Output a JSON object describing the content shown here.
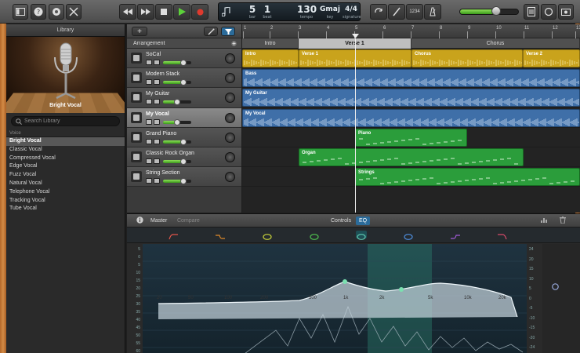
{
  "colors": {
    "region_yellow": "#c9a31c",
    "region_blue": "#3f6fa8",
    "region_green": "#2b9d3b",
    "accent_blue": "#2b6b9a",
    "eq_teal": "#5ec9b0"
  },
  "toolbar": {
    "buttons_left": [
      "library-icon",
      "help-icon",
      "smart-controls-icon",
      "editors-icon"
    ],
    "transport": [
      "rewind-icon",
      "forward-icon",
      "stop-icon",
      "play-icon",
      "record-icon"
    ],
    "lcd": {
      "bar": "5",
      "beat": "1",
      "bar_label": "bar",
      "beat_label": "beat",
      "tempo": "130",
      "tempo_label": "tempo",
      "key": "Gmaj",
      "key_label": "key",
      "signature": "4/4",
      "signature_label": "signature"
    },
    "count_in": "1234",
    "master_volume": 0.6
  },
  "library": {
    "title": "Library",
    "image_label": "Bright Vocal",
    "search_placeholder": "Search Library",
    "category": "Voice",
    "items": [
      "Bright Vocal",
      "Classic Vocal",
      "Compressed Vocal",
      "Edge Vocal",
      "Fuzz Vocal",
      "Natural Vocal",
      "Telephone Vocal",
      "Tracking Vocal",
      "Tube Vocal"
    ],
    "selected_index": 0
  },
  "tracks_head": {
    "add_label": "+",
    "arrangement_label": "Arrangement"
  },
  "tracks": [
    {
      "name": "SoCal",
      "icon": "drums-icon",
      "volume": 0.72
    },
    {
      "name": "Modern Stack",
      "icon": "bass-amp-icon",
      "volume": 0.72
    },
    {
      "name": "My Guitar",
      "icon": "guitar-icon",
      "volume": 0.5
    },
    {
      "name": "My Vocal",
      "icon": "microphone-icon",
      "volume": 0.5,
      "selected": true
    },
    {
      "name": "Grand Piano",
      "icon": "piano-icon",
      "volume": 0.72
    },
    {
      "name": "Classic Rock Organ",
      "icon": "organ-icon",
      "volume": 0.72
    },
    {
      "name": "String Section",
      "icon": "strings-icon",
      "volume": 0.72
    }
  ],
  "timeline": {
    "ruler": [
      "1",
      "2",
      "3",
      "4",
      "5",
      "6",
      "7",
      "8",
      "9",
      "10",
      "11",
      "12",
      "13"
    ],
    "sections": [
      {
        "label": "Intro"
      },
      {
        "label": "Verse 1",
        "selected": true
      },
      {
        "label": "Chorus"
      }
    ],
    "lanes": [
      [
        {
          "label": "Intro",
          "color": "yellow"
        },
        {
          "label": "Verse 1",
          "color": "yellow"
        },
        {
          "label": "Chorus",
          "color": "yellow"
        },
        {
          "label": "Verse 2",
          "color": "yellow"
        }
      ],
      [
        {
          "label": "Bass",
          "color": "blue"
        }
      ],
      [
        {
          "label": "My Guitar",
          "color": "blue"
        }
      ],
      [
        {
          "label": "My Vocal",
          "color": "blue"
        }
      ],
      [
        {
          "label": "Piano",
          "color": "green"
        }
      ],
      [
        {
          "label": "Organ",
          "color": "green"
        }
      ],
      [
        {
          "label": "Strings",
          "color": "green"
        }
      ]
    ]
  },
  "editor": {
    "info_label": "i",
    "master_label": "Master",
    "compare_label": "Compare",
    "controls_label": "Controls",
    "eq_label": "EQ",
    "freq_labels": [
      "20",
      "50",
      "100",
      "200",
      "500",
      "1k",
      "2k",
      "5k",
      "10k",
      "20k"
    ],
    "left_scale": [
      "5",
      "0",
      "5",
      "10",
      "15",
      "20",
      "25",
      "30",
      "35",
      "40",
      "45",
      "50",
      "55",
      "60"
    ],
    "right_scale": [
      "24",
      "20",
      "15",
      "10",
      "5",
      "0",
      "-5",
      "-10",
      "-15",
      "-20",
      "-24"
    ]
  }
}
